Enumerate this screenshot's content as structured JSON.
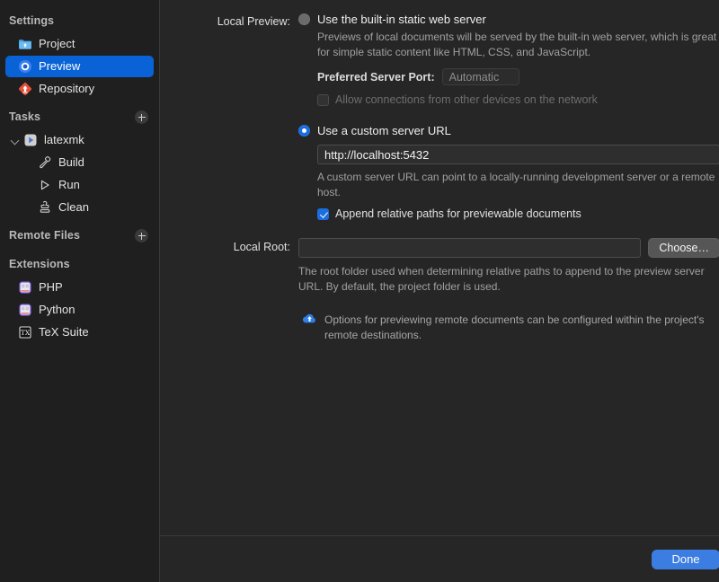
{
  "sidebar": {
    "sections": [
      {
        "title": "Settings",
        "has_add": false,
        "items": [
          {
            "label": "Project",
            "icon": "project-folder-icon",
            "selected": false
          },
          {
            "label": "Preview",
            "icon": "preview-target-icon",
            "selected": true
          },
          {
            "label": "Repository",
            "icon": "repository-diamond-icon",
            "selected": false
          }
        ]
      },
      {
        "title": "Tasks",
        "has_add": true,
        "add_label": "+",
        "items": [
          {
            "label": "latexmk",
            "icon": "task-run-icon",
            "selected": false
          },
          {
            "label": "Build",
            "icon": "hammer-icon",
            "selected": false
          },
          {
            "label": "Run",
            "icon": "play-icon",
            "selected": false
          },
          {
            "label": "Clean",
            "icon": "stamp-icon",
            "selected": false
          }
        ]
      },
      {
        "title": "Remote Files",
        "has_add": true,
        "add_label": "+",
        "items": []
      },
      {
        "title": "Extensions",
        "has_add": false,
        "items": [
          {
            "label": "PHP",
            "icon": "extension-icon",
            "selected": false
          },
          {
            "label": "Python",
            "icon": "extension-icon",
            "selected": false
          },
          {
            "label": "TeX Suite",
            "icon": "tex-extension-icon",
            "selected": false
          }
        ]
      }
    ]
  },
  "main": {
    "local_preview_label": "Local Preview:",
    "builtin": {
      "radio_label": "Use the built-in static web server",
      "selected": false,
      "description": "Previews of local documents will be served by the built-in web server, which is great for simple static content like HTML, CSS, and JavaScript.",
      "port_label": "Preferred Server Port:",
      "port_placeholder": "Automatic",
      "port_value": "",
      "allow_connections_label": "Allow connections from other devices on the network",
      "allow_connections_checked": false,
      "allow_connections_enabled": false
    },
    "custom": {
      "radio_label": "Use a custom server URL",
      "selected": true,
      "url_value": "http://localhost:5432",
      "description": "A custom server URL can point to a locally-running development server or a remote host.",
      "append_label": "Append relative paths for previewable documents",
      "append_checked": true
    },
    "local_root": {
      "label": "Local Root:",
      "value": "",
      "choose_label": "Choose…",
      "description": "The root folder used when determining relative paths to append to the preview server URL. By default, the project folder is used."
    },
    "remote_note": {
      "icon": "cloud-upload-icon",
      "text": "Options for previewing remote documents can be configured within the project's remote destinations."
    }
  },
  "footer": {
    "done_label": "Done"
  },
  "colors": {
    "accent_blue": "#1b6ee0",
    "selection_blue": "#0a63d6",
    "done_blue": "#3b7de0",
    "sidebar_bg": "#1f1f1f",
    "main_bg": "#262626"
  }
}
